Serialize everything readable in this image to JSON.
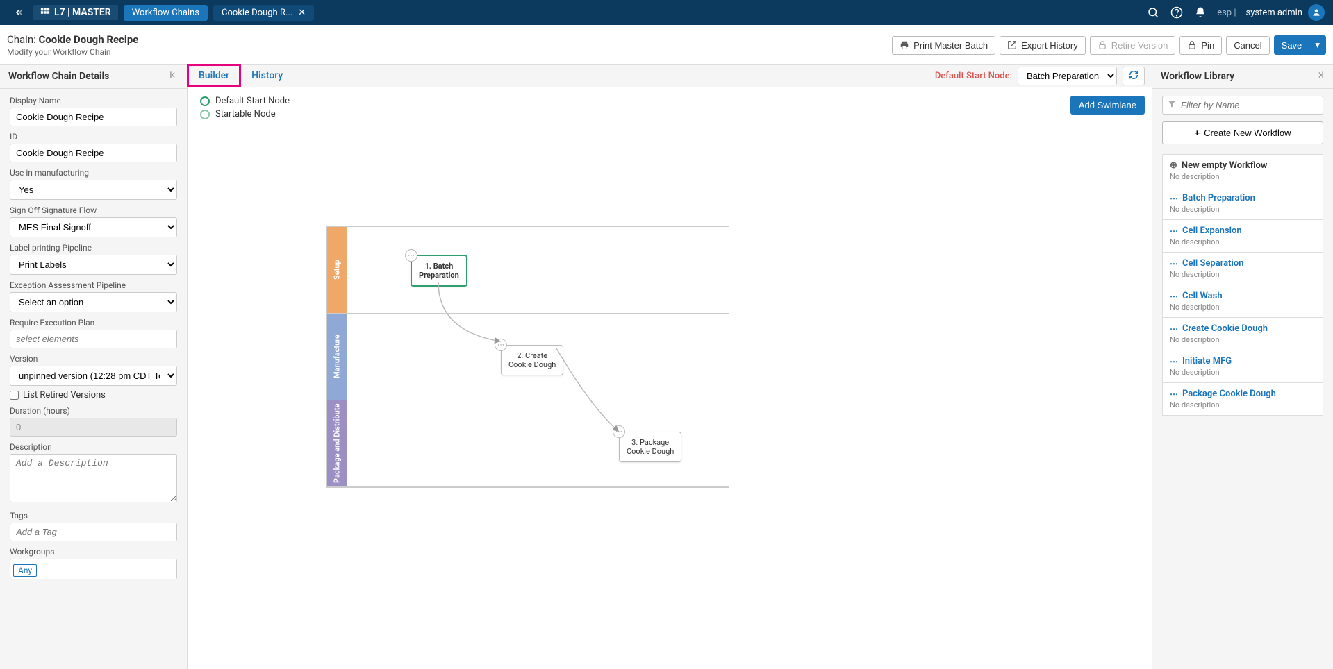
{
  "topBar": {
    "logo": "L7 | MASTER",
    "pillActive": "Workflow Chains",
    "tabTitle": "Cookie Dough R...",
    "espLabel": "esp |",
    "userName": "system admin"
  },
  "header": {
    "chainPrefix": "Chain: ",
    "chainName": "Cookie Dough Recipe",
    "subtitle": "Modify your Workflow Chain",
    "printBtn": "Print Master Batch",
    "exportBtn": "Export History",
    "retireBtn": "Retire Version",
    "pinBtn": "Pin",
    "cancelBtn": "Cancel",
    "saveBtn": "Save"
  },
  "leftPanel": {
    "title": "Workflow Chain Details",
    "labels": {
      "displayName": "Display Name",
      "id": "ID",
      "useInMfg": "Use in manufacturing",
      "signOff": "Sign Off Signature Flow",
      "labelPipeline": "Label printing Pipeline",
      "exceptionPipeline": "Exception Assessment Pipeline",
      "requirePlan": "Require Execution Plan",
      "version": "Version",
      "listRetired": "List Retired Versions",
      "duration": "Duration (hours)",
      "description": "Description",
      "tags": "Tags",
      "workgroups": "Workgroups"
    },
    "values": {
      "displayName": "Cookie Dough Recipe",
      "id": "Cookie Dough Recipe",
      "useInMfg": "Yes",
      "signOff": "MES Final Signoff",
      "labelPipeline": "Print Labels",
      "exceptionPipeline": "Select an option",
      "requirePlanPlaceholder": "select elements",
      "version": "unpinned version (12:28 pm CDT To...",
      "duration": "0",
      "descPlaceholder": "Add a Description",
      "tagsPlaceholder": "Add a Tag",
      "workgroupChip": "Any"
    }
  },
  "centerPanel": {
    "tabBuilder": "Builder",
    "tabHistory": "History",
    "defaultStartLabel": "Default Start Node:",
    "defaultStartValue": "Batch Preparation",
    "legend": {
      "default": "Default Start Node",
      "startable": "Startable Node"
    },
    "addSwimlane": "Add Swimlane",
    "lanes": {
      "setup": "Setup",
      "mfg": "Manufacture",
      "pkg": "Package and Distribute"
    },
    "nodes": {
      "n1a": "1. Batch",
      "n1b": "Preparation",
      "n2a": "2. Create",
      "n2b": "Cookie Dough",
      "n3a": "3. Package",
      "n3b": "Cookie Dough"
    }
  },
  "rightPanel": {
    "title": "Workflow Library",
    "filterPlaceholder": "Filter by Name",
    "createBtn": "Create New Workflow",
    "noDesc": "No description",
    "items": [
      {
        "title": "New empty Workflow",
        "link": false
      },
      {
        "title": "Batch Preparation",
        "link": true
      },
      {
        "title": "Cell Expansion",
        "link": true
      },
      {
        "title": "Cell Separation",
        "link": true
      },
      {
        "title": "Cell Wash",
        "link": true
      },
      {
        "title": "Create Cookie Dough",
        "link": true
      },
      {
        "title": "Initiate MFG",
        "link": true
      },
      {
        "title": "Package Cookie Dough",
        "link": true
      }
    ]
  }
}
